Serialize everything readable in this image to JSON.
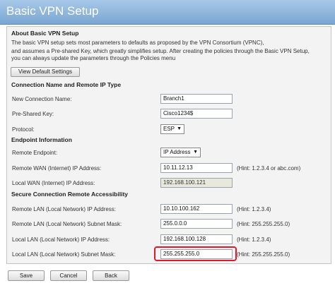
{
  "window": {
    "title": "Basic VPN Setup"
  },
  "about": {
    "header": "About Basic VPN Setup",
    "description": [
      "The basic VPN setup sets most parameters to defaults as proposed by the VPN Consortium (VPNC),",
      "and assumes a Pre-shared Key, which greatly simplifies setup. After creating the policies through the Basic VPN Setup,",
      "you can always update the parameters through the Policies menu"
    ],
    "view_defaults_label": "View Default Settings"
  },
  "connection": {
    "header": "Connection Name and Remote IP Type",
    "fields": [
      {
        "label": "New Connection Name:",
        "value": "Branch1"
      },
      {
        "label": "Pre-Shared Key:",
        "value": "Cisco1234$"
      }
    ],
    "protocol": {
      "label": "Protocol:",
      "value": "ESP"
    }
  },
  "endpoint": {
    "header": "Endpoint Information",
    "remote_endpoint": {
      "label": "Remote Endpoint:",
      "value": "IP Address"
    },
    "remote_wan": {
      "label": "Remote WAN (Internet) IP Address:",
      "value": "10.11.12.13",
      "hint": "(Hint: 1.2.3.4 or abc.com)"
    },
    "local_wan": {
      "label": "Local WAN (Internet) IP Address:",
      "value": "192.168.100.121"
    }
  },
  "secure": {
    "header": "Secure Connection Remote Accessibility",
    "fields": [
      {
        "label": "Remote LAN (Local Network) IP Address:",
        "value": "10.10.100.162",
        "hint": "(Hint: 1.2.3.4)"
      },
      {
        "label": "Remote LAN (Local Network) Subnet Mask:",
        "value": "255.0.0.0",
        "hint": "(Hint: 255.255.255.0)"
      },
      {
        "label": "Local LAN (Local Network) IP Address:",
        "value": "192.168.100.128",
        "hint": "(Hint: 1.2.3.4)"
      },
      {
        "label": "Local LAN (Local Network) Subnet Mask:",
        "value": "255.255.255.0",
        "hint": "(Hint: 255.255.255.0)"
      }
    ]
  },
  "actions": {
    "save": "Save",
    "cancel": "Cancel",
    "back": "Back"
  },
  "colors": {
    "title_bar": "#7aa6d2",
    "highlight": "#e0182a"
  }
}
